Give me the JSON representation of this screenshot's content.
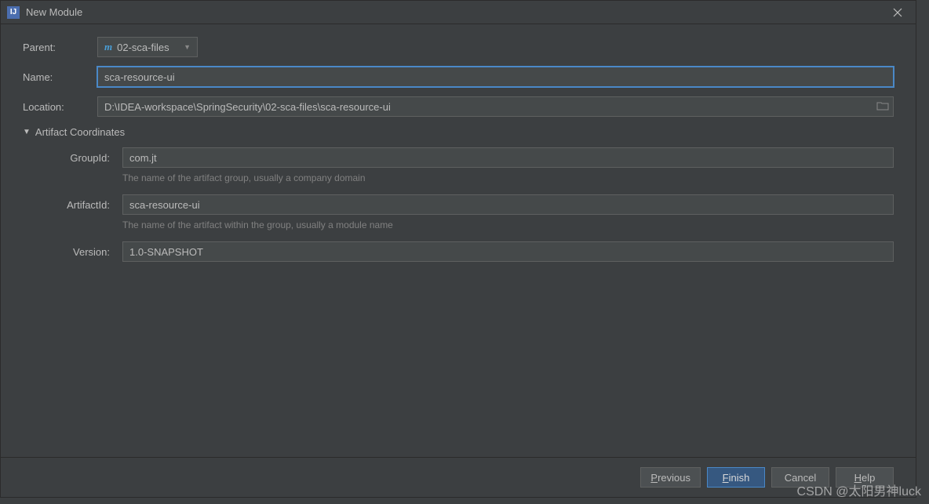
{
  "window": {
    "title": "New Module"
  },
  "form": {
    "parent_label": "Parent:",
    "parent_value": "02-sca-files",
    "name_label": "Name:",
    "name_value": "sca-resource-ui",
    "location_label": "Location:",
    "location_value": "D:\\IDEA-workspace\\SpringSecurity\\02-sca-files\\sca-resource-ui"
  },
  "artifact": {
    "section_title": "Artifact Coordinates",
    "groupid_label": "GroupId:",
    "groupid_value": "com.jt",
    "groupid_hint": "The name of the artifact group, usually a company domain",
    "artifactid_label": "ArtifactId:",
    "artifactid_value": "sca-resource-ui",
    "artifactid_hint": "The name of the artifact within the group, usually a module name",
    "version_label": "Version:",
    "version_value": "1.0-SNAPSHOT"
  },
  "buttons": {
    "previous": "Previous",
    "finish": "Finish",
    "cancel": "Cancel",
    "help": "Help"
  },
  "watermark": "CSDN @太阳男神luck"
}
